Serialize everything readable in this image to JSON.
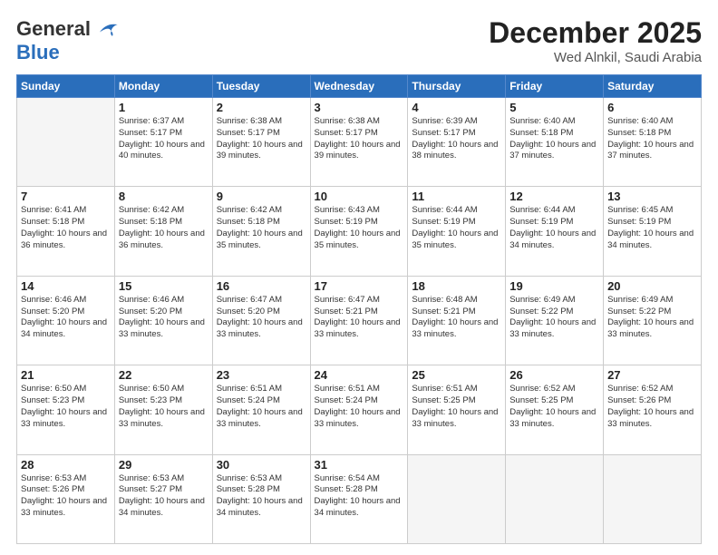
{
  "header": {
    "logo_general": "General",
    "logo_blue": "Blue",
    "month_title": "December 2025",
    "subtitle": "Wed Alnkil, Saudi Arabia"
  },
  "days_of_week": [
    "Sunday",
    "Monday",
    "Tuesday",
    "Wednesday",
    "Thursday",
    "Friday",
    "Saturday"
  ],
  "weeks": [
    [
      {
        "day": "",
        "empty": true
      },
      {
        "day": "1",
        "sunrise": "Sunrise: 6:37 AM",
        "sunset": "Sunset: 5:17 PM",
        "daylight": "Daylight: 10 hours and 40 minutes."
      },
      {
        "day": "2",
        "sunrise": "Sunrise: 6:38 AM",
        "sunset": "Sunset: 5:17 PM",
        "daylight": "Daylight: 10 hours and 39 minutes."
      },
      {
        "day": "3",
        "sunrise": "Sunrise: 6:38 AM",
        "sunset": "Sunset: 5:17 PM",
        "daylight": "Daylight: 10 hours and 39 minutes."
      },
      {
        "day": "4",
        "sunrise": "Sunrise: 6:39 AM",
        "sunset": "Sunset: 5:17 PM",
        "daylight": "Daylight: 10 hours and 38 minutes."
      },
      {
        "day": "5",
        "sunrise": "Sunrise: 6:40 AM",
        "sunset": "Sunset: 5:18 PM",
        "daylight": "Daylight: 10 hours and 37 minutes."
      },
      {
        "day": "6",
        "sunrise": "Sunrise: 6:40 AM",
        "sunset": "Sunset: 5:18 PM",
        "daylight": "Daylight: 10 hours and 37 minutes."
      }
    ],
    [
      {
        "day": "7",
        "sunrise": "Sunrise: 6:41 AM",
        "sunset": "Sunset: 5:18 PM",
        "daylight": "Daylight: 10 hours and 36 minutes."
      },
      {
        "day": "8",
        "sunrise": "Sunrise: 6:42 AM",
        "sunset": "Sunset: 5:18 PM",
        "daylight": "Daylight: 10 hours and 36 minutes."
      },
      {
        "day": "9",
        "sunrise": "Sunrise: 6:42 AM",
        "sunset": "Sunset: 5:18 PM",
        "daylight": "Daylight: 10 hours and 35 minutes."
      },
      {
        "day": "10",
        "sunrise": "Sunrise: 6:43 AM",
        "sunset": "Sunset: 5:19 PM",
        "daylight": "Daylight: 10 hours and 35 minutes."
      },
      {
        "day": "11",
        "sunrise": "Sunrise: 6:44 AM",
        "sunset": "Sunset: 5:19 PM",
        "daylight": "Daylight: 10 hours and 35 minutes."
      },
      {
        "day": "12",
        "sunrise": "Sunrise: 6:44 AM",
        "sunset": "Sunset: 5:19 PM",
        "daylight": "Daylight: 10 hours and 34 minutes."
      },
      {
        "day": "13",
        "sunrise": "Sunrise: 6:45 AM",
        "sunset": "Sunset: 5:19 PM",
        "daylight": "Daylight: 10 hours and 34 minutes."
      }
    ],
    [
      {
        "day": "14",
        "sunrise": "Sunrise: 6:46 AM",
        "sunset": "Sunset: 5:20 PM",
        "daylight": "Daylight: 10 hours and 34 minutes."
      },
      {
        "day": "15",
        "sunrise": "Sunrise: 6:46 AM",
        "sunset": "Sunset: 5:20 PM",
        "daylight": "Daylight: 10 hours and 33 minutes."
      },
      {
        "day": "16",
        "sunrise": "Sunrise: 6:47 AM",
        "sunset": "Sunset: 5:20 PM",
        "daylight": "Daylight: 10 hours and 33 minutes."
      },
      {
        "day": "17",
        "sunrise": "Sunrise: 6:47 AM",
        "sunset": "Sunset: 5:21 PM",
        "daylight": "Daylight: 10 hours and 33 minutes."
      },
      {
        "day": "18",
        "sunrise": "Sunrise: 6:48 AM",
        "sunset": "Sunset: 5:21 PM",
        "daylight": "Daylight: 10 hours and 33 minutes."
      },
      {
        "day": "19",
        "sunrise": "Sunrise: 6:49 AM",
        "sunset": "Sunset: 5:22 PM",
        "daylight": "Daylight: 10 hours and 33 minutes."
      },
      {
        "day": "20",
        "sunrise": "Sunrise: 6:49 AM",
        "sunset": "Sunset: 5:22 PM",
        "daylight": "Daylight: 10 hours and 33 minutes."
      }
    ],
    [
      {
        "day": "21",
        "sunrise": "Sunrise: 6:50 AM",
        "sunset": "Sunset: 5:23 PM",
        "daylight": "Daylight: 10 hours and 33 minutes."
      },
      {
        "day": "22",
        "sunrise": "Sunrise: 6:50 AM",
        "sunset": "Sunset: 5:23 PM",
        "daylight": "Daylight: 10 hours and 33 minutes."
      },
      {
        "day": "23",
        "sunrise": "Sunrise: 6:51 AM",
        "sunset": "Sunset: 5:24 PM",
        "daylight": "Daylight: 10 hours and 33 minutes."
      },
      {
        "day": "24",
        "sunrise": "Sunrise: 6:51 AM",
        "sunset": "Sunset: 5:24 PM",
        "daylight": "Daylight: 10 hours and 33 minutes."
      },
      {
        "day": "25",
        "sunrise": "Sunrise: 6:51 AM",
        "sunset": "Sunset: 5:25 PM",
        "daylight": "Daylight: 10 hours and 33 minutes."
      },
      {
        "day": "26",
        "sunrise": "Sunrise: 6:52 AM",
        "sunset": "Sunset: 5:25 PM",
        "daylight": "Daylight: 10 hours and 33 minutes."
      },
      {
        "day": "27",
        "sunrise": "Sunrise: 6:52 AM",
        "sunset": "Sunset: 5:26 PM",
        "daylight": "Daylight: 10 hours and 33 minutes."
      }
    ],
    [
      {
        "day": "28",
        "sunrise": "Sunrise: 6:53 AM",
        "sunset": "Sunset: 5:26 PM",
        "daylight": "Daylight: 10 hours and 33 minutes."
      },
      {
        "day": "29",
        "sunrise": "Sunrise: 6:53 AM",
        "sunset": "Sunset: 5:27 PM",
        "daylight": "Daylight: 10 hours and 34 minutes."
      },
      {
        "day": "30",
        "sunrise": "Sunrise: 6:53 AM",
        "sunset": "Sunset: 5:28 PM",
        "daylight": "Daylight: 10 hours and 34 minutes."
      },
      {
        "day": "31",
        "sunrise": "Sunrise: 6:54 AM",
        "sunset": "Sunset: 5:28 PM",
        "daylight": "Daylight: 10 hours and 34 minutes."
      },
      {
        "day": "",
        "empty": true
      },
      {
        "day": "",
        "empty": true
      },
      {
        "day": "",
        "empty": true
      }
    ]
  ]
}
